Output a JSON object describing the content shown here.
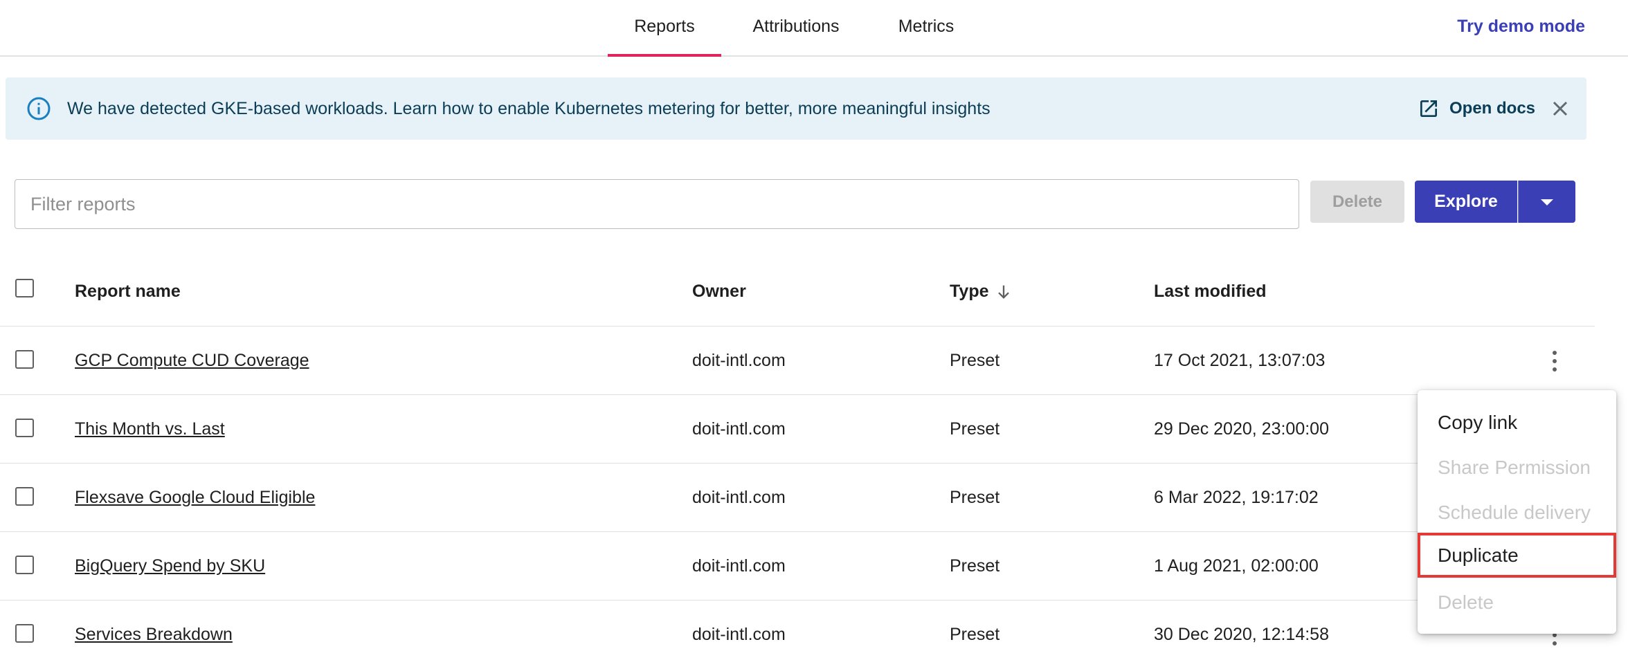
{
  "nav": {
    "tabs": [
      {
        "label": "Reports",
        "active": true
      },
      {
        "label": "Attributions",
        "active": false
      },
      {
        "label": "Metrics",
        "active": false
      }
    ],
    "demo_link": "Try demo mode"
  },
  "banner": {
    "icon": "info-icon",
    "message": "We have detected GKE-based workloads. Learn how to enable Kubernetes metering for better, more meaningful insights",
    "docs_label": "Open docs",
    "docs_icon": "open-in-new-icon",
    "close_icon": "close-icon"
  },
  "toolbar": {
    "filter_placeholder": "Filter reports",
    "filter_value": "",
    "delete_label": "Delete",
    "explore_label": "Explore"
  },
  "table": {
    "headers": {
      "name": "Report name",
      "owner": "Owner",
      "type": "Type",
      "modified": "Last modified"
    },
    "sort": {
      "column": "Type",
      "direction": "descending",
      "icon": "arrow-down-icon"
    },
    "rows": [
      {
        "name": "GCP Compute CUD Coverage",
        "owner": "doit-intl.com",
        "type": "Preset",
        "modified": "17 Oct 2021, 13:07:03"
      },
      {
        "name": "This Month vs. Last",
        "owner": "doit-intl.com",
        "type": "Preset",
        "modified": "29 Dec 2020, 23:00:00"
      },
      {
        "name": "Flexsave Google Cloud Eligible",
        "owner": "doit-intl.com",
        "type": "Preset",
        "modified": "6 Mar 2022, 19:17:02"
      },
      {
        "name": "BigQuery Spend by SKU",
        "owner": "doit-intl.com",
        "type": "Preset",
        "modified": "1 Aug 2021, 02:00:00"
      },
      {
        "name": "Services Breakdown",
        "owner": "doit-intl.com",
        "type": "Preset",
        "modified": "30 Dec 2020, 12:14:58"
      }
    ]
  },
  "context_menu": {
    "items": [
      {
        "label": "Copy link",
        "disabled": false
      },
      {
        "label": "Share Permission",
        "disabled": true
      },
      {
        "label": "Schedule delivery",
        "disabled": true
      },
      {
        "label": "Duplicate",
        "disabled": false,
        "highlighted": true
      },
      {
        "label": "Delete",
        "disabled": true
      }
    ]
  },
  "colors": {
    "accent": "#3b3fb6",
    "tab_indicator": "#e0245e",
    "banner_bg": "#e6f2f8",
    "highlight": "#e53935"
  }
}
